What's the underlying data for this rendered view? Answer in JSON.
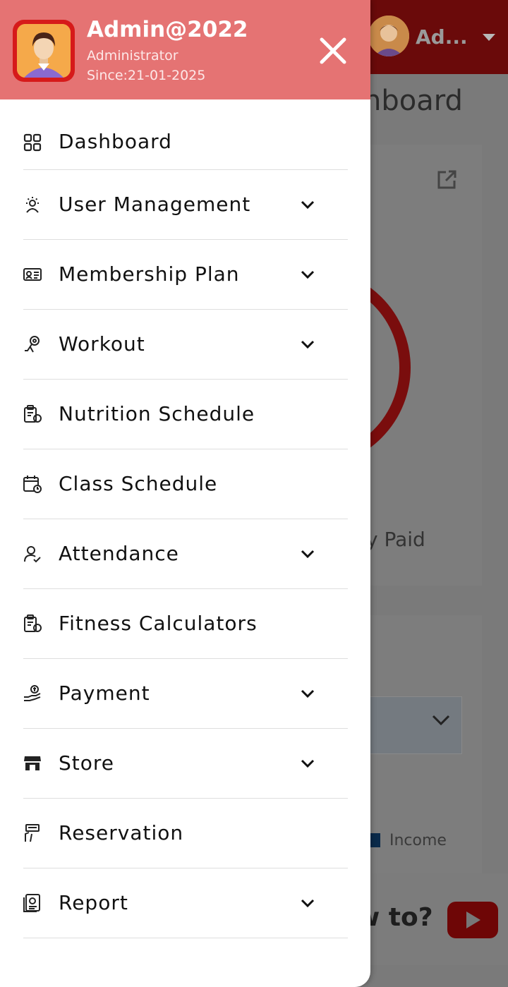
{
  "background": {
    "user_short": "Ad...",
    "page_title": "nboard",
    "paid_label": "y Paid",
    "legend_income": "Income",
    "help_text": "w to?"
  },
  "drawer": {
    "admin_name": "Admin@2022",
    "admin_role": "Administrator",
    "admin_since": "Since:21-01-2025",
    "menu": [
      {
        "label": "Dashboard",
        "icon": "dashboard-icon",
        "has_submenu": false
      },
      {
        "label": "User Management",
        "icon": "users-gear-icon",
        "has_submenu": true
      },
      {
        "label": "Membership Plan",
        "icon": "membership-card-icon",
        "has_submenu": true
      },
      {
        "label": "Workout",
        "icon": "workout-icon",
        "has_submenu": true
      },
      {
        "label": "Nutrition Schedule",
        "icon": "clipboard-apple-icon",
        "has_submenu": false
      },
      {
        "label": "Class Schedule",
        "icon": "calendar-clock-icon",
        "has_submenu": false
      },
      {
        "label": "Attendance",
        "icon": "user-check-icon",
        "has_submenu": true
      },
      {
        "label": "Fitness Calculators",
        "icon": "clipboard-apple-icon",
        "has_submenu": false
      },
      {
        "label": "Payment",
        "icon": "payment-hand-icon",
        "has_submenu": true
      },
      {
        "label": "Store",
        "icon": "store-icon",
        "has_submenu": true
      },
      {
        "label": "Reservation",
        "icon": "reservation-icon",
        "has_submenu": false
      },
      {
        "label": "Report",
        "icon": "report-icon",
        "has_submenu": true
      }
    ]
  },
  "colors": {
    "header": "#e57373",
    "topbar": "#6a0a0a",
    "avatar_frame": "#d61a1a",
    "avatar_bg": "#f5a94a"
  }
}
